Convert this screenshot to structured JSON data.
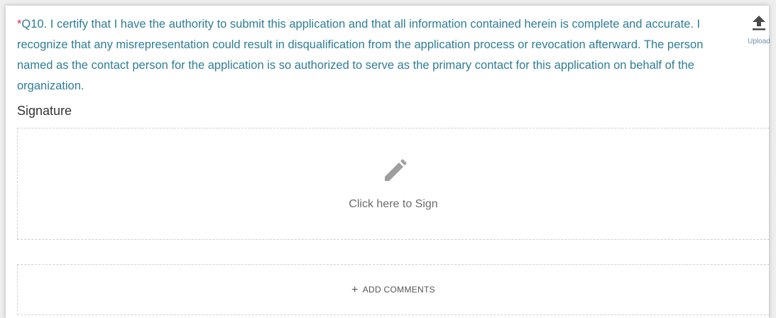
{
  "question": {
    "required_marker": "*",
    "text": "Q10.  I certify that I have the authority to submit this application and that all information contained herein is complete and accurate. I recognize that any misrepresentation could result in disqualification from the application process or revocation afterward. The person named as the contact person for the application is so authorized to serve as the primary contact for this application on behalf of the organization."
  },
  "upload": {
    "label": "Upload",
    "icon": "upload-icon"
  },
  "signature": {
    "title": "Signature",
    "prompt": "Click here to Sign",
    "icon": "pencil-icon"
  },
  "comments": {
    "label": "ADD COMMENTS",
    "icon": "plus-icon"
  },
  "colors": {
    "question_text": "#2e7d96",
    "required": "#d32f4f",
    "icon_gray": "#9e9e9e"
  }
}
